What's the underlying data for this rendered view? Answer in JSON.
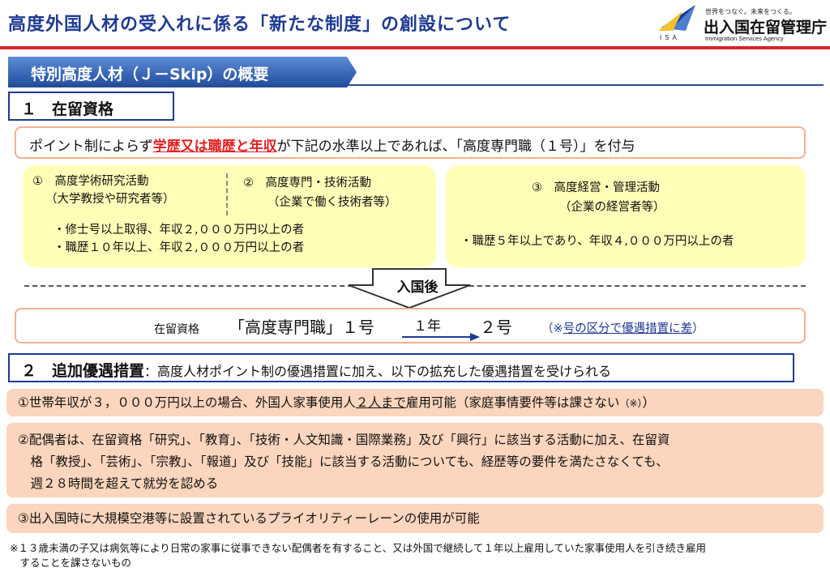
{
  "header": {
    "title": "高度外国人材の受入れに係る「新たな制度」の創設について",
    "logo": {
      "mark_text": "ISA",
      "tagline": "世界をつなぐ。未来をつくる。",
      "name": "出入国在留管理庁",
      "english": "Immigration Services Agency"
    }
  },
  "banner": {
    "text": "特別高度人材（Ｊ－Skip）の概要"
  },
  "section1": {
    "heading": "１　在留資格",
    "rule_pre": "ポイント制によらず",
    "rule_red": "学歴又は職歴と年収",
    "rule_post": "が下記の水準以上であれば、「高度専門職（１号）」を付与",
    "box_left": {
      "col1_title": "①　高度学術研究活動",
      "col1_sub": "（大学教授や研究者等）",
      "col2_title": "②　高度専門・技術活動",
      "col2_sub": "（企業で働く技術者等）",
      "bullet1": "・修士号以上取得、年収２,０００万円以上の者",
      "bullet2": "・職歴１０年以上、年収２,０００万円以上の者"
    },
    "box_right": {
      "title": "③　高度経営・管理活動",
      "sub": "（企業の経営者等）",
      "bullet": "・職歴５年以上であり、年収４,０００万円以上の者"
    },
    "arrow_label": "入国後",
    "status": {
      "prefix": "在留資格",
      "main": "「高度専門職」１号",
      "duration": "１年",
      "next": "２号",
      "note_pre": "（※",
      "note_link": "号の区分で優遇措置に差",
      "note_post": "）"
    }
  },
  "section2": {
    "heading_big": "２　追加優遇措置",
    "heading_rest": "：高度人材ポイント制の優遇措置に加え、以下の拡充した優遇措置を受けられる",
    "item1_pre": "①世帯年収が３，０００万円以上の場合、外国人家事使用人",
    "item1_u": "２人まで",
    "item1_post": "雇用可能（家庭事情要件等は課さない",
    "item1_note": "（※）",
    "item1_end": "）",
    "item2_line1": "②配偶者は、在留資格「研究」、「教育」、「技術・人文知識・国際業務」及び「興行」に該当する活動に加え、在留資",
    "item2_line2": "　格「教授」、「芸術」、「宗教」、「報道」及び「技能」に該当する活動についても、経歴等の要件を満たさなくても、",
    "item2_line3": "　週２８時間を超えて就労を認める",
    "item3": "③出入国時に大規模空港等に設置されているプライオリティーレーンの使用が可能"
  },
  "footnote": {
    "line1": "※１３歳未満の子又は病気等により日常の家事に従事できない配偶者を有すること、又は外国で継続して１年以上雇用していた家事使用人を引き続き雇用",
    "line2": "　することを課さないもの"
  },
  "colors": {
    "title_blue": "#1f3a93",
    "red_rule": "#d2262b",
    "yellow_box": "#ffffb8",
    "orange_box": "#fbd5bd",
    "highlight_red": "#e02020"
  }
}
